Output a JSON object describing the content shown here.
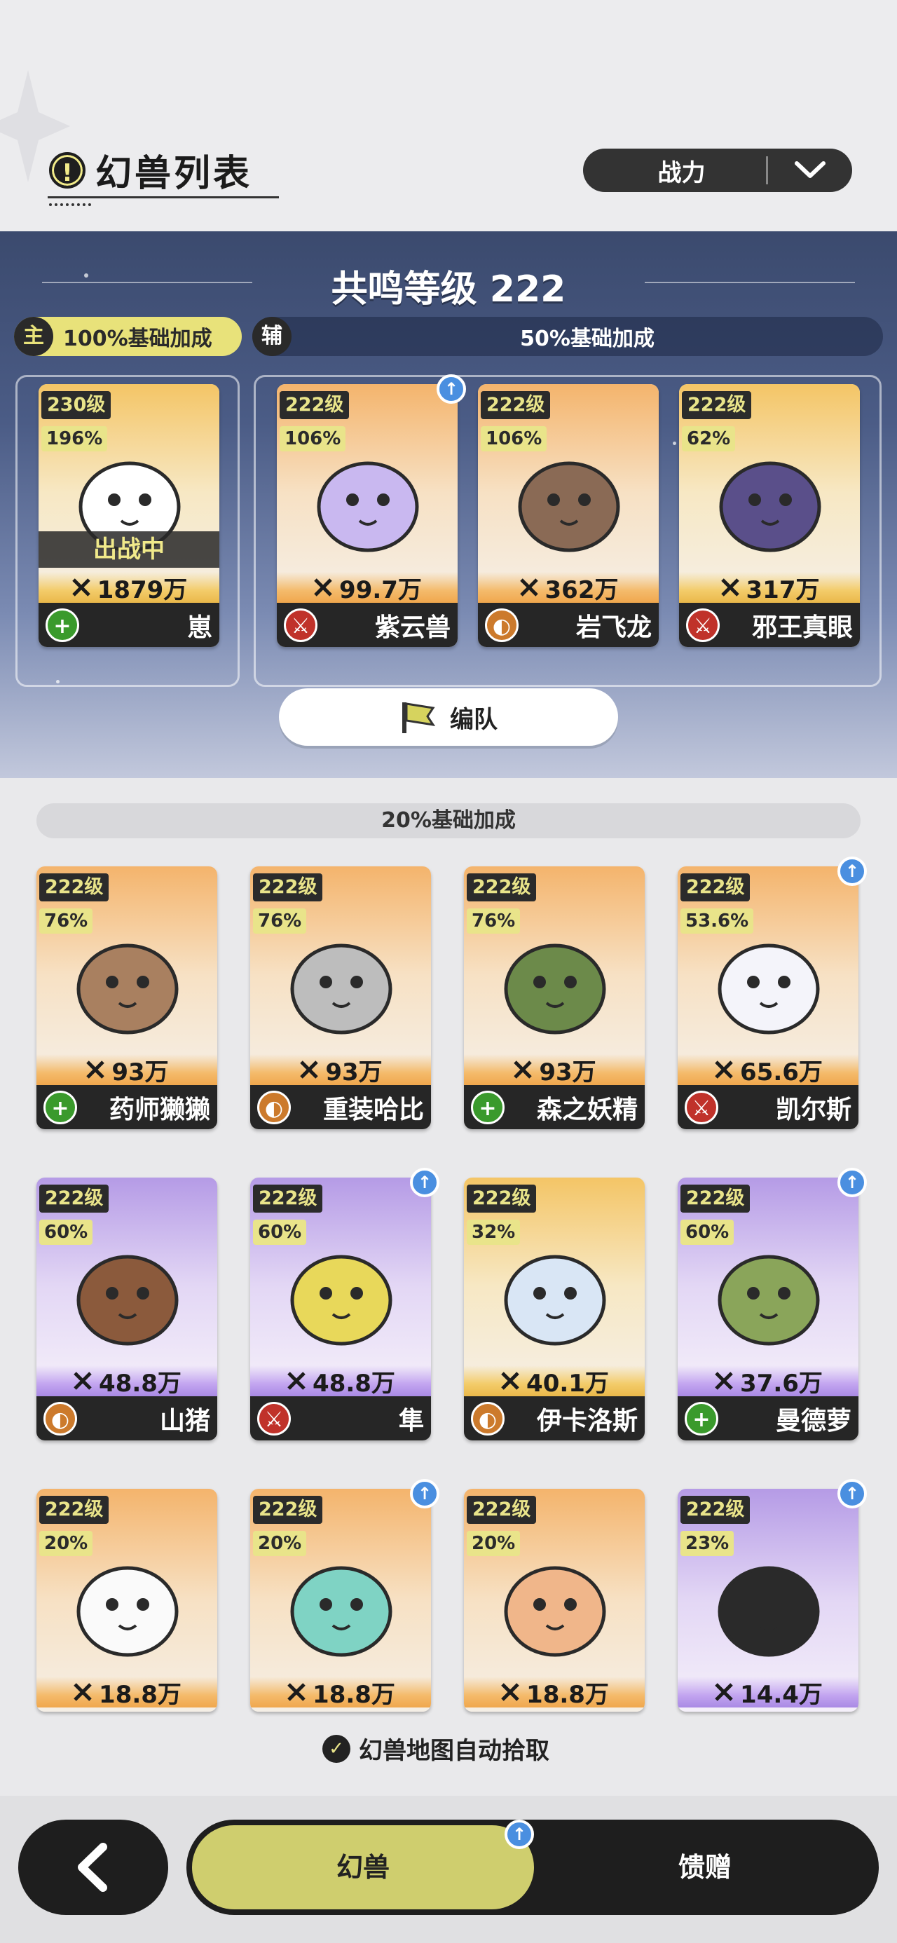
{
  "header": {
    "title": "幻兽列表",
    "sort_label": "战力"
  },
  "team": {
    "resonance_label": "共鸣等级 222",
    "main_tag_icon": "主",
    "main_tag_text": "100%基础加成",
    "sub_tag_icon": "辅",
    "sub_tag_text": "50%基础加成",
    "formation_label": "编队",
    "battle_status": "出战中",
    "cards": [
      {
        "level": "230级",
        "pct": "196%",
        "power": "1879万",
        "name": "崽",
        "role": "heal",
        "frame": "gold"
      },
      {
        "level": "222级",
        "pct": "106%",
        "power": "99.7万",
        "name": "紫云兽",
        "role": "atk",
        "frame": "orange",
        "upgrade": true
      },
      {
        "level": "222级",
        "pct": "106%",
        "power": "362万",
        "name": "岩飞龙",
        "role": "def",
        "frame": "orange"
      },
      {
        "level": "222级",
        "pct": "62%",
        "power": "317万",
        "name": "邪王真眼",
        "role": "atk",
        "frame": "gold"
      }
    ]
  },
  "list": {
    "band_label": "20%基础加成",
    "cards": [
      {
        "level": "222级",
        "pct": "76%",
        "power": "93万",
        "name": "药师獭獭",
        "role": "heal",
        "frame": "orange"
      },
      {
        "level": "222级",
        "pct": "76%",
        "power": "93万",
        "name": "重装哈比",
        "role": "def",
        "frame": "orange"
      },
      {
        "level": "222级",
        "pct": "76%",
        "power": "93万",
        "name": "森之妖精",
        "role": "heal",
        "frame": "orange"
      },
      {
        "level": "222级",
        "pct": "53.6%",
        "power": "65.6万",
        "name": "凯尔斯",
        "role": "atk",
        "frame": "orange",
        "upgrade": true
      },
      {
        "level": "222级",
        "pct": "60%",
        "power": "48.8万",
        "name": "山猪",
        "role": "def",
        "frame": "purple"
      },
      {
        "level": "222级",
        "pct": "60%",
        "power": "48.8万",
        "name": "隼",
        "role": "atk",
        "frame": "purple",
        "upgrade": true
      },
      {
        "level": "222级",
        "pct": "32%",
        "power": "40.1万",
        "name": "伊卡洛斯",
        "role": "def",
        "frame": "gold"
      },
      {
        "level": "222级",
        "pct": "60%",
        "power": "37.6万",
        "name": "曼德萝",
        "role": "heal",
        "frame": "purple",
        "upgrade": true
      },
      {
        "level": "222级",
        "pct": "20%",
        "power": "18.8万",
        "name": "",
        "role": "",
        "frame": "orange"
      },
      {
        "level": "222级",
        "pct": "20%",
        "power": "18.8万",
        "name": "",
        "role": "",
        "frame": "orange",
        "upgrade": true
      },
      {
        "level": "222级",
        "pct": "20%",
        "power": "18.8万",
        "name": "",
        "role": "",
        "frame": "orange"
      },
      {
        "level": "222级",
        "pct": "23%",
        "power": "14.4万",
        "name": "",
        "role": "",
        "frame": "purple",
        "upgrade": true
      }
    ],
    "autopick_label": "幻兽地图自动拾取"
  },
  "nav": {
    "tab_beasts": "幻兽",
    "tab_gift": "馈赠"
  },
  "colors": {
    "accent": "#cfce6e",
    "dark": "#1e1e1e",
    "heal": "#3a9a2c",
    "atk": "#c0322a",
    "def": "#cc7a2c",
    "upgrade": "#4a8fe0"
  },
  "icons": {
    "sort": "chevron-down-icon",
    "back": "back-arrow-icon",
    "info": "info-icon",
    "power": "crossed-swords-icon",
    "formation": "flag-icon",
    "check": "check-circle-icon"
  }
}
